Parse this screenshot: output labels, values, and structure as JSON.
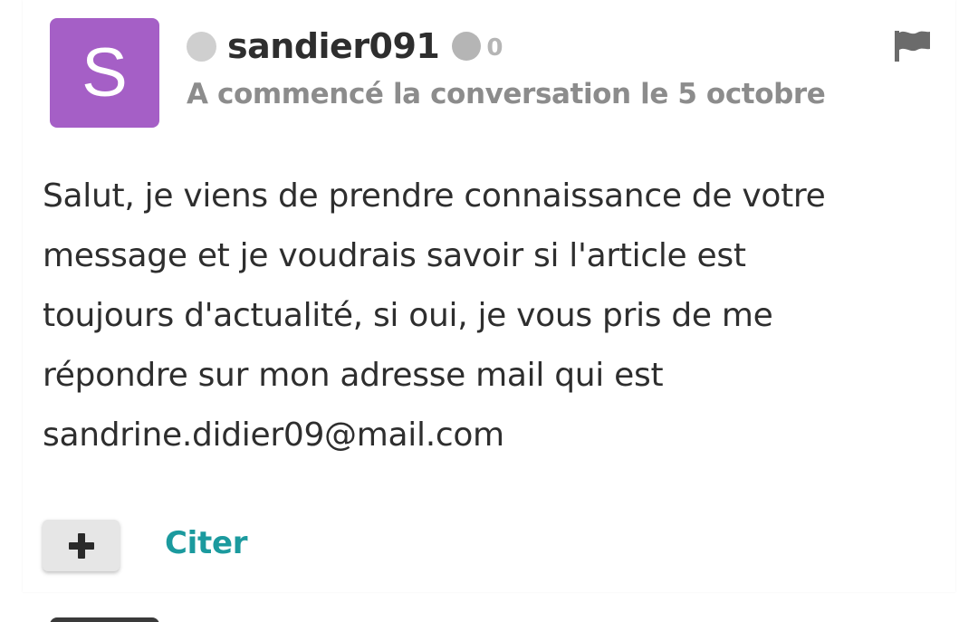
{
  "post": {
    "avatar": {
      "letter": "S",
      "color": "#a55fc6"
    },
    "author": {
      "username": "sandier091",
      "status": "offline",
      "reputation_icon": "reputation-badge-icon",
      "reputation": "0"
    },
    "subtitle": "A commencé la conversation le 5 octobre",
    "flag_icon": "flag-icon",
    "message": "Salut, je viens de prendre connaissance de votre\nmessage et je voudrais savoir si l'article est\ntoujours d'actualité, si oui, je vous pris de me\nrépondre sur mon adresse mail qui est\nsandrine.didier09@mail.com",
    "actions": {
      "plus_icon": "plus-icon",
      "quote_label": "Citer"
    }
  },
  "colors": {
    "accent": "#1b9a9e",
    "text": "#2e2e2e",
    "muted": "#8c8c8c"
  }
}
